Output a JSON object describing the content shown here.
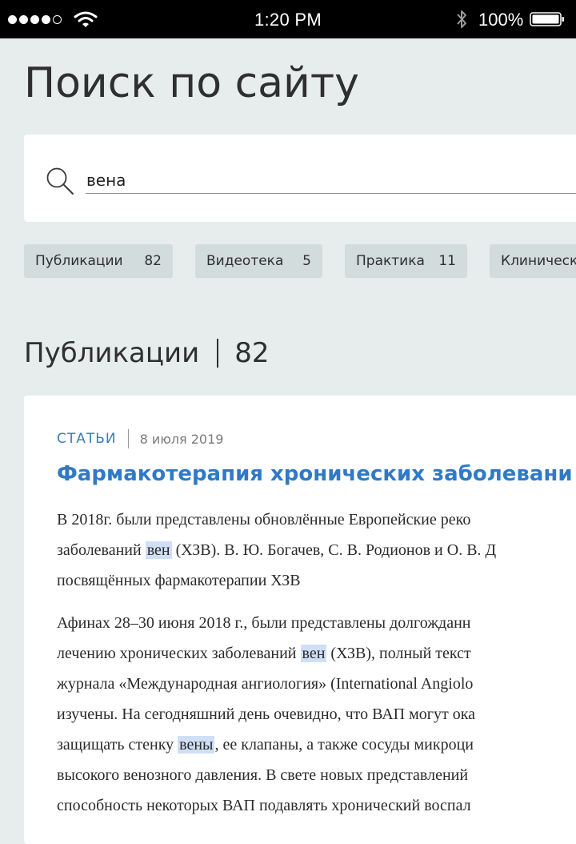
{
  "status_bar": {
    "time": "1:20 PM",
    "battery_percent": "100%",
    "signal_filled": 4,
    "signal_total": 5
  },
  "page": {
    "title": "Поиск по сайту"
  },
  "search": {
    "value": "вена",
    "placeholder": ""
  },
  "chips": [
    {
      "label": "Публикации",
      "count": "82"
    },
    {
      "label": "Видеотека",
      "count": "5"
    },
    {
      "label": "Практика",
      "count": "11"
    },
    {
      "label": "Клиническ",
      "count": ""
    }
  ],
  "section": {
    "title": "Публикации",
    "count": "82"
  },
  "result": {
    "category": "СТАТЬИ",
    "date": "8 июля 2019",
    "title": "Фармакотерапия хронических заболевани",
    "snippet1": {
      "l1": "В 2018г. были представлены обновлённые Европейские реко",
      "l2_pre": "заболеваний ",
      "l2_hl": "вен",
      "l2_post": " (ХЗВ). В. Ю. Богачев, С. В. Родионов и О. В. Д",
      "l3": "посвящённых фармакотерапии ХЗВ"
    },
    "snippet2": {
      "l1": "Афинах 28–30 июня 2018 г., были представлены долгожданн",
      "l2_pre": "лечению хронических заболеваний ",
      "l2_hl": "вен",
      "l2_post": " (ХЗВ), полный текст",
      "l3": "журнала «Международная ангиология» (International Angiolo",
      "l4": "изучены. На сегодняшний день очевидно, что ВАП могут ока",
      "l5_pre": "защищать стенку ",
      "l5_hl": "вены",
      "l5_post": ", ее клапаны, а также сосуды микроци",
      "l6": "высокого венозного давления. В свете новых представлений",
      "l7": "способность некоторых ВАП подавлять хронический воспал"
    }
  },
  "colors": {
    "background": "#e7ecec",
    "accent": "#2f7ac6",
    "chip": "#d2dcdc",
    "highlight": "#cfdff5"
  }
}
